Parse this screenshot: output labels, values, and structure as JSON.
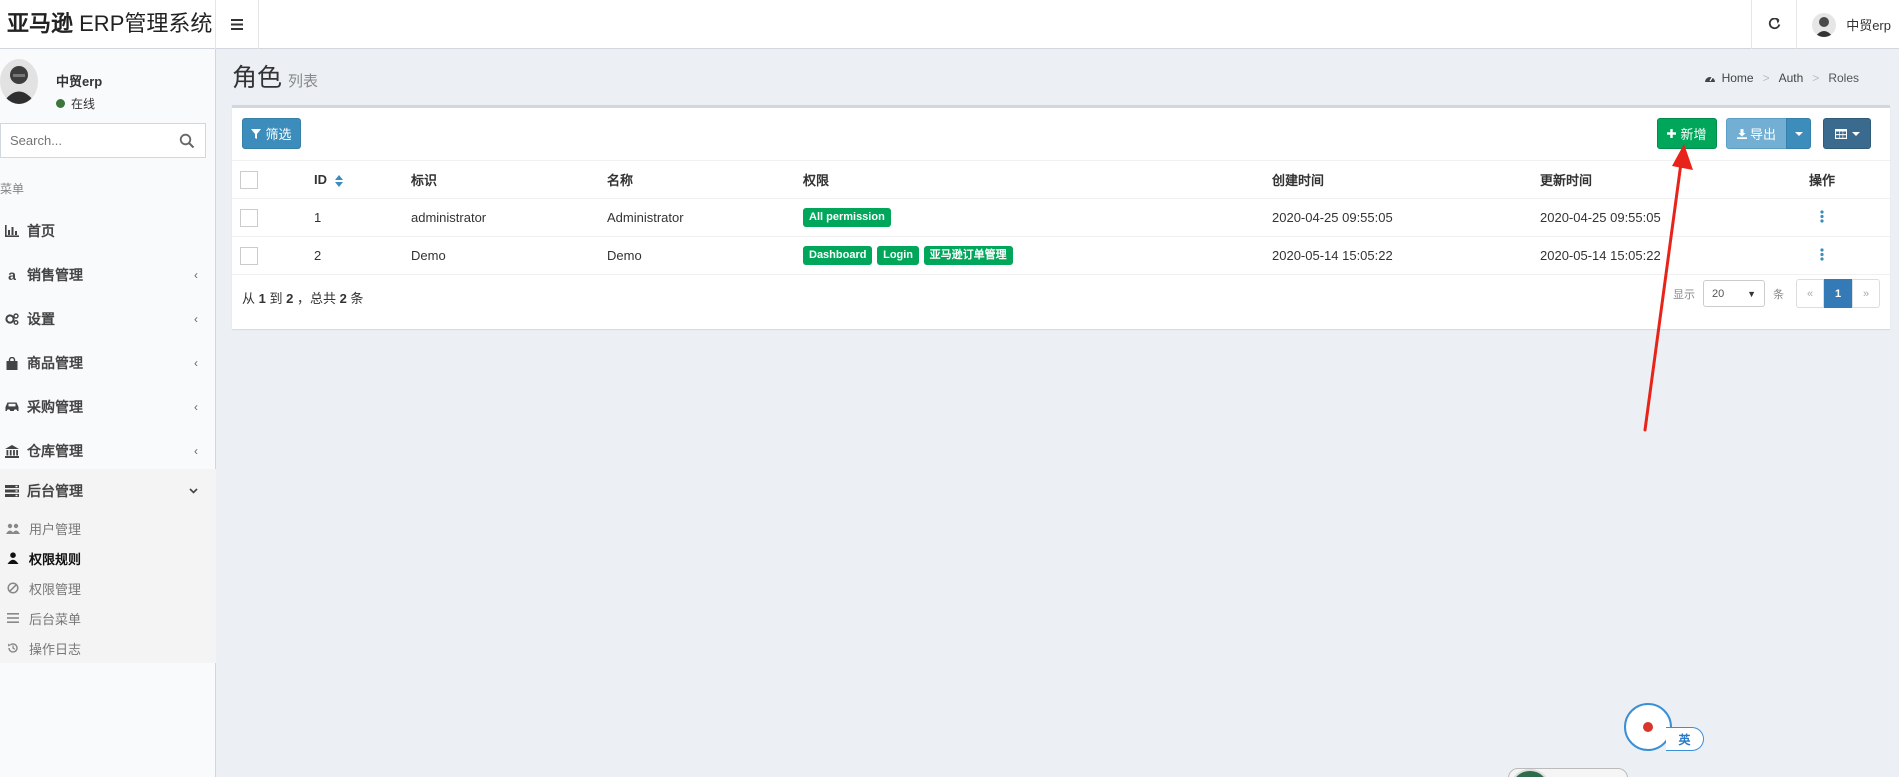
{
  "header": {
    "logo_bold": "亚马逊",
    "logo_rest": " ERP管理系统",
    "user_name": "中贸erp"
  },
  "sidebar": {
    "user_name": "中贸erp",
    "status": "在线",
    "search_placeholder": "Search...",
    "menu_header": "菜单",
    "items": [
      {
        "label": "首页",
        "icon": "bar-chart-icon"
      },
      {
        "label": "销售管理",
        "icon": "amazon-icon"
      },
      {
        "label": "设置",
        "icon": "cogs-icon"
      },
      {
        "label": "商品管理",
        "icon": "shopping-bag-icon"
      },
      {
        "label": "采购管理",
        "icon": "car-icon"
      },
      {
        "label": "仓库管理",
        "icon": "bank-icon"
      },
      {
        "label": "后台管理",
        "icon": "server-icon"
      }
    ],
    "subitems": [
      {
        "label": "用户管理",
        "icon": "users-icon"
      },
      {
        "label": "权限规则",
        "icon": "user-icon"
      },
      {
        "label": "权限管理",
        "icon": "ban-icon"
      },
      {
        "label": "后台菜单",
        "icon": "bars-icon"
      },
      {
        "label": "操作日志",
        "icon": "history-icon"
      }
    ]
  },
  "page": {
    "title": "角色",
    "subtitle": "列表",
    "breadcrumb": [
      "Home",
      "Auth",
      "Roles"
    ]
  },
  "toolbar": {
    "filter": "筛选",
    "new": "新增",
    "export": "导出"
  },
  "table": {
    "columns": [
      "ID",
      "标识",
      "名称",
      "权限",
      "创建时间",
      "更新时间",
      "操作"
    ],
    "rows": [
      {
        "id": "1",
        "slug": "administrator",
        "name": "Administrator",
        "permissions": [
          "All permission"
        ],
        "created": "2020-04-25 09:55:05",
        "updated": "2020-04-25 09:55:05"
      },
      {
        "id": "2",
        "slug": "Demo",
        "name": "Demo",
        "permissions": [
          "Dashboard",
          "Login",
          "亚马逊订单管理"
        ],
        "created": "2020-05-14 15:05:22",
        "updated": "2020-05-14 15:05:22"
      }
    ]
  },
  "footer": {
    "summary_pre": "从 ",
    "from": "1",
    "summary_mid": " 到 ",
    "to": "2",
    "summary_mid2": " ，总共 ",
    "total": "2",
    "summary_post": " 条",
    "show_label": "显示",
    "per_page": "20",
    "per_suffix": "条",
    "prev": "«",
    "current_page": "1",
    "next": "»"
  },
  "ime": {
    "mode": "英"
  },
  "colors": {
    "primary": "#3c8dbc",
    "success": "#00a65a",
    "annotation": "#e8241a"
  }
}
